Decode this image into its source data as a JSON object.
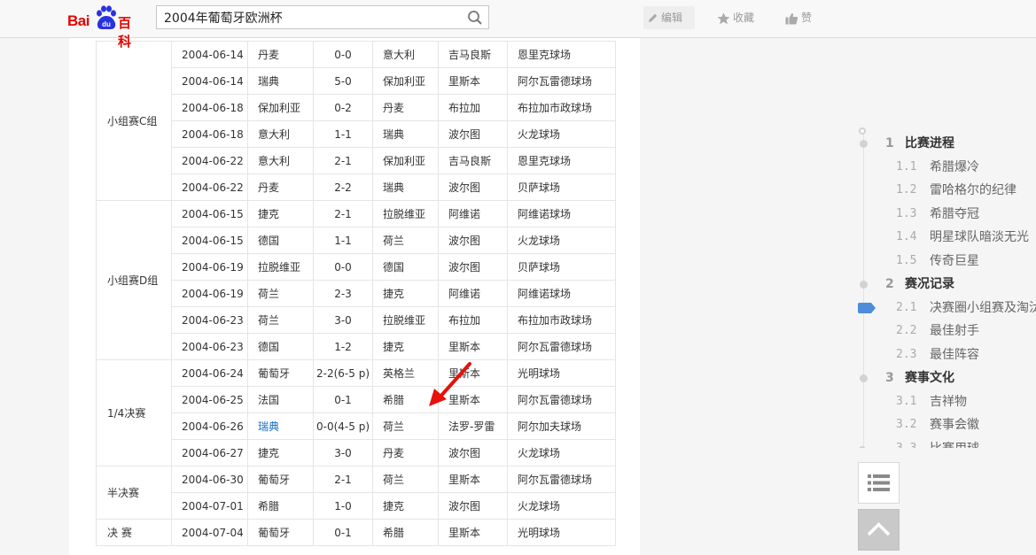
{
  "brand": {
    "logo_text_latin": "Bai",
    "logo_text_paw": "du",
    "logo_text_cn": "百科"
  },
  "search": {
    "value": "2004年葡萄牙欧洲杯"
  },
  "toolbar": {
    "edit_label": "编辑",
    "fav_label": "收藏",
    "like_label": "赞"
  },
  "matches": [
    {
      "stage": "小组赛C组",
      "span": 6,
      "date": "2004-06-14",
      "team1": "丹麦",
      "score": "0-0",
      "team2": "意大利",
      "referee": "吉马良斯",
      "venue": "恩里克球场"
    },
    {
      "date": "2004-06-14",
      "team1": "瑞典",
      "score": "5-0",
      "team2": "保加利亚",
      "referee": "里斯本",
      "venue": "阿尔瓦雷德球场"
    },
    {
      "date": "2004-06-18",
      "team1": "保加利亚",
      "score": "0-2",
      "team2": "丹麦",
      "referee": "布拉加",
      "venue": "布拉加市政球场"
    },
    {
      "date": "2004-06-18",
      "team1": "意大利",
      "score": "1-1",
      "team2": "瑞典",
      "referee": "波尔图",
      "venue": "火龙球场"
    },
    {
      "date": "2004-06-22",
      "team1": "意大利",
      "score": "2-1",
      "team2": "保加利亚",
      "referee": "吉马良斯",
      "venue": "恩里克球场"
    },
    {
      "date": "2004-06-22",
      "team1": "丹麦",
      "score": "2-2",
      "team2": "瑞典",
      "referee": "波尔图",
      "venue": "贝萨球场"
    },
    {
      "stage": "小组赛D组",
      "span": 6,
      "date": "2004-06-15",
      "team1": "捷克",
      "score": "2-1",
      "team2": "拉脱维亚",
      "referee": "阿维诺",
      "venue": "阿维诺球场"
    },
    {
      "date": "2004-06-15",
      "team1": "德国",
      "score": "1-1",
      "team2": "荷兰",
      "referee": "波尔图",
      "venue": "火龙球场"
    },
    {
      "date": "2004-06-19",
      "team1": "拉脱维亚",
      "score": "0-0",
      "team2": "德国",
      "referee": "波尔图",
      "venue": "贝萨球场"
    },
    {
      "date": "2004-06-19",
      "team1": "荷兰",
      "score": "2-3",
      "team2": "捷克",
      "referee": "阿维诺",
      "venue": "阿维诺球场"
    },
    {
      "date": "2004-06-23",
      "team1": "荷兰",
      "score": "3-0",
      "team2": "拉脱维亚",
      "referee": "布拉加",
      "venue": "布拉加市政球场"
    },
    {
      "date": "2004-06-23",
      "team1": "德国",
      "score": "1-2",
      "team2": "捷克",
      "referee": "里斯本",
      "venue": "阿尔瓦雷德球场"
    },
    {
      "stage": "1/4决赛",
      "span": 4,
      "date": "2004-06-24",
      "team1": "葡萄牙",
      "score": "2-2(6-5 p)",
      "team2": "英格兰",
      "referee": "里斯本",
      "venue": "光明球场"
    },
    {
      "date": "2004-06-25",
      "team1": "法国",
      "score": "0-1",
      "team2": "希腊",
      "referee": "里斯本",
      "venue": "阿尔瓦雷德球场"
    },
    {
      "date": "2004-06-26",
      "team1": "瑞典",
      "team1_link": true,
      "score": "0-0(4-5 p)",
      "team2": "荷兰",
      "referee": "法罗-罗雷",
      "venue": "阿尔加夫球场"
    },
    {
      "date": "2004-06-27",
      "team1": "捷克",
      "score": "3-0",
      "team2": "丹麦",
      "referee": "波尔图",
      "venue": "火龙球场"
    },
    {
      "stage": "半决赛",
      "span": 2,
      "date": "2004-06-30",
      "team1": "葡萄牙",
      "score": "2-1",
      "team2": "荷兰",
      "referee": "里斯本",
      "venue": "阿尔瓦雷德球场"
    },
    {
      "date": "2004-07-01",
      "team1": "希腊",
      "score": "1-0",
      "team2": "捷克",
      "referee": "波尔图",
      "venue": "火龙球场"
    },
    {
      "stage": "决 赛",
      "span": 1,
      "date": "2004-07-04",
      "team1": "葡萄牙",
      "score": "0-1",
      "team2": "希腊",
      "referee": "里斯本",
      "venue": "光明球场"
    }
  ],
  "catalog": [
    {
      "level": 1,
      "num": "1",
      "text": "比赛进程"
    },
    {
      "level": 2,
      "num": "1.1",
      "text": "希腊爆冷"
    },
    {
      "level": 2,
      "num": "1.2",
      "text": "雷哈格尔的纪律"
    },
    {
      "level": 2,
      "num": "1.3",
      "text": "希腊夺冠"
    },
    {
      "level": 2,
      "num": "1.4",
      "text": "明星球队暗淡无光"
    },
    {
      "level": 2,
      "num": "1.5",
      "text": "传奇巨星"
    },
    {
      "level": 1,
      "num": "2",
      "text": "赛况记录"
    },
    {
      "level": 2,
      "num": "2.1",
      "text": "决赛圈小组赛及淘汰赛",
      "active": true
    },
    {
      "level": 2,
      "num": "2.2",
      "text": "最佳射手"
    },
    {
      "level": 2,
      "num": "2.3",
      "text": "最佳阵容"
    },
    {
      "level": 1,
      "num": "3",
      "text": "赛事文化"
    },
    {
      "level": 2,
      "num": "3.1",
      "text": "吉祥物"
    },
    {
      "level": 2,
      "num": "3.2",
      "text": "赛事会徽"
    },
    {
      "level": 2,
      "num": "3.3",
      "text": "比赛用球"
    }
  ],
  "colors": {
    "brand_red": "#e10601",
    "link_blue": "#136ec2",
    "active_marker": "#4d8ed9",
    "annotation_arrow": "#e8100a"
  },
  "icons": {
    "search": "search-icon",
    "edit": "pencil-icon",
    "fav": "star-icon",
    "like": "thumbs-up-icon",
    "catalog": "list-icon",
    "top": "chevron-up-icon"
  }
}
